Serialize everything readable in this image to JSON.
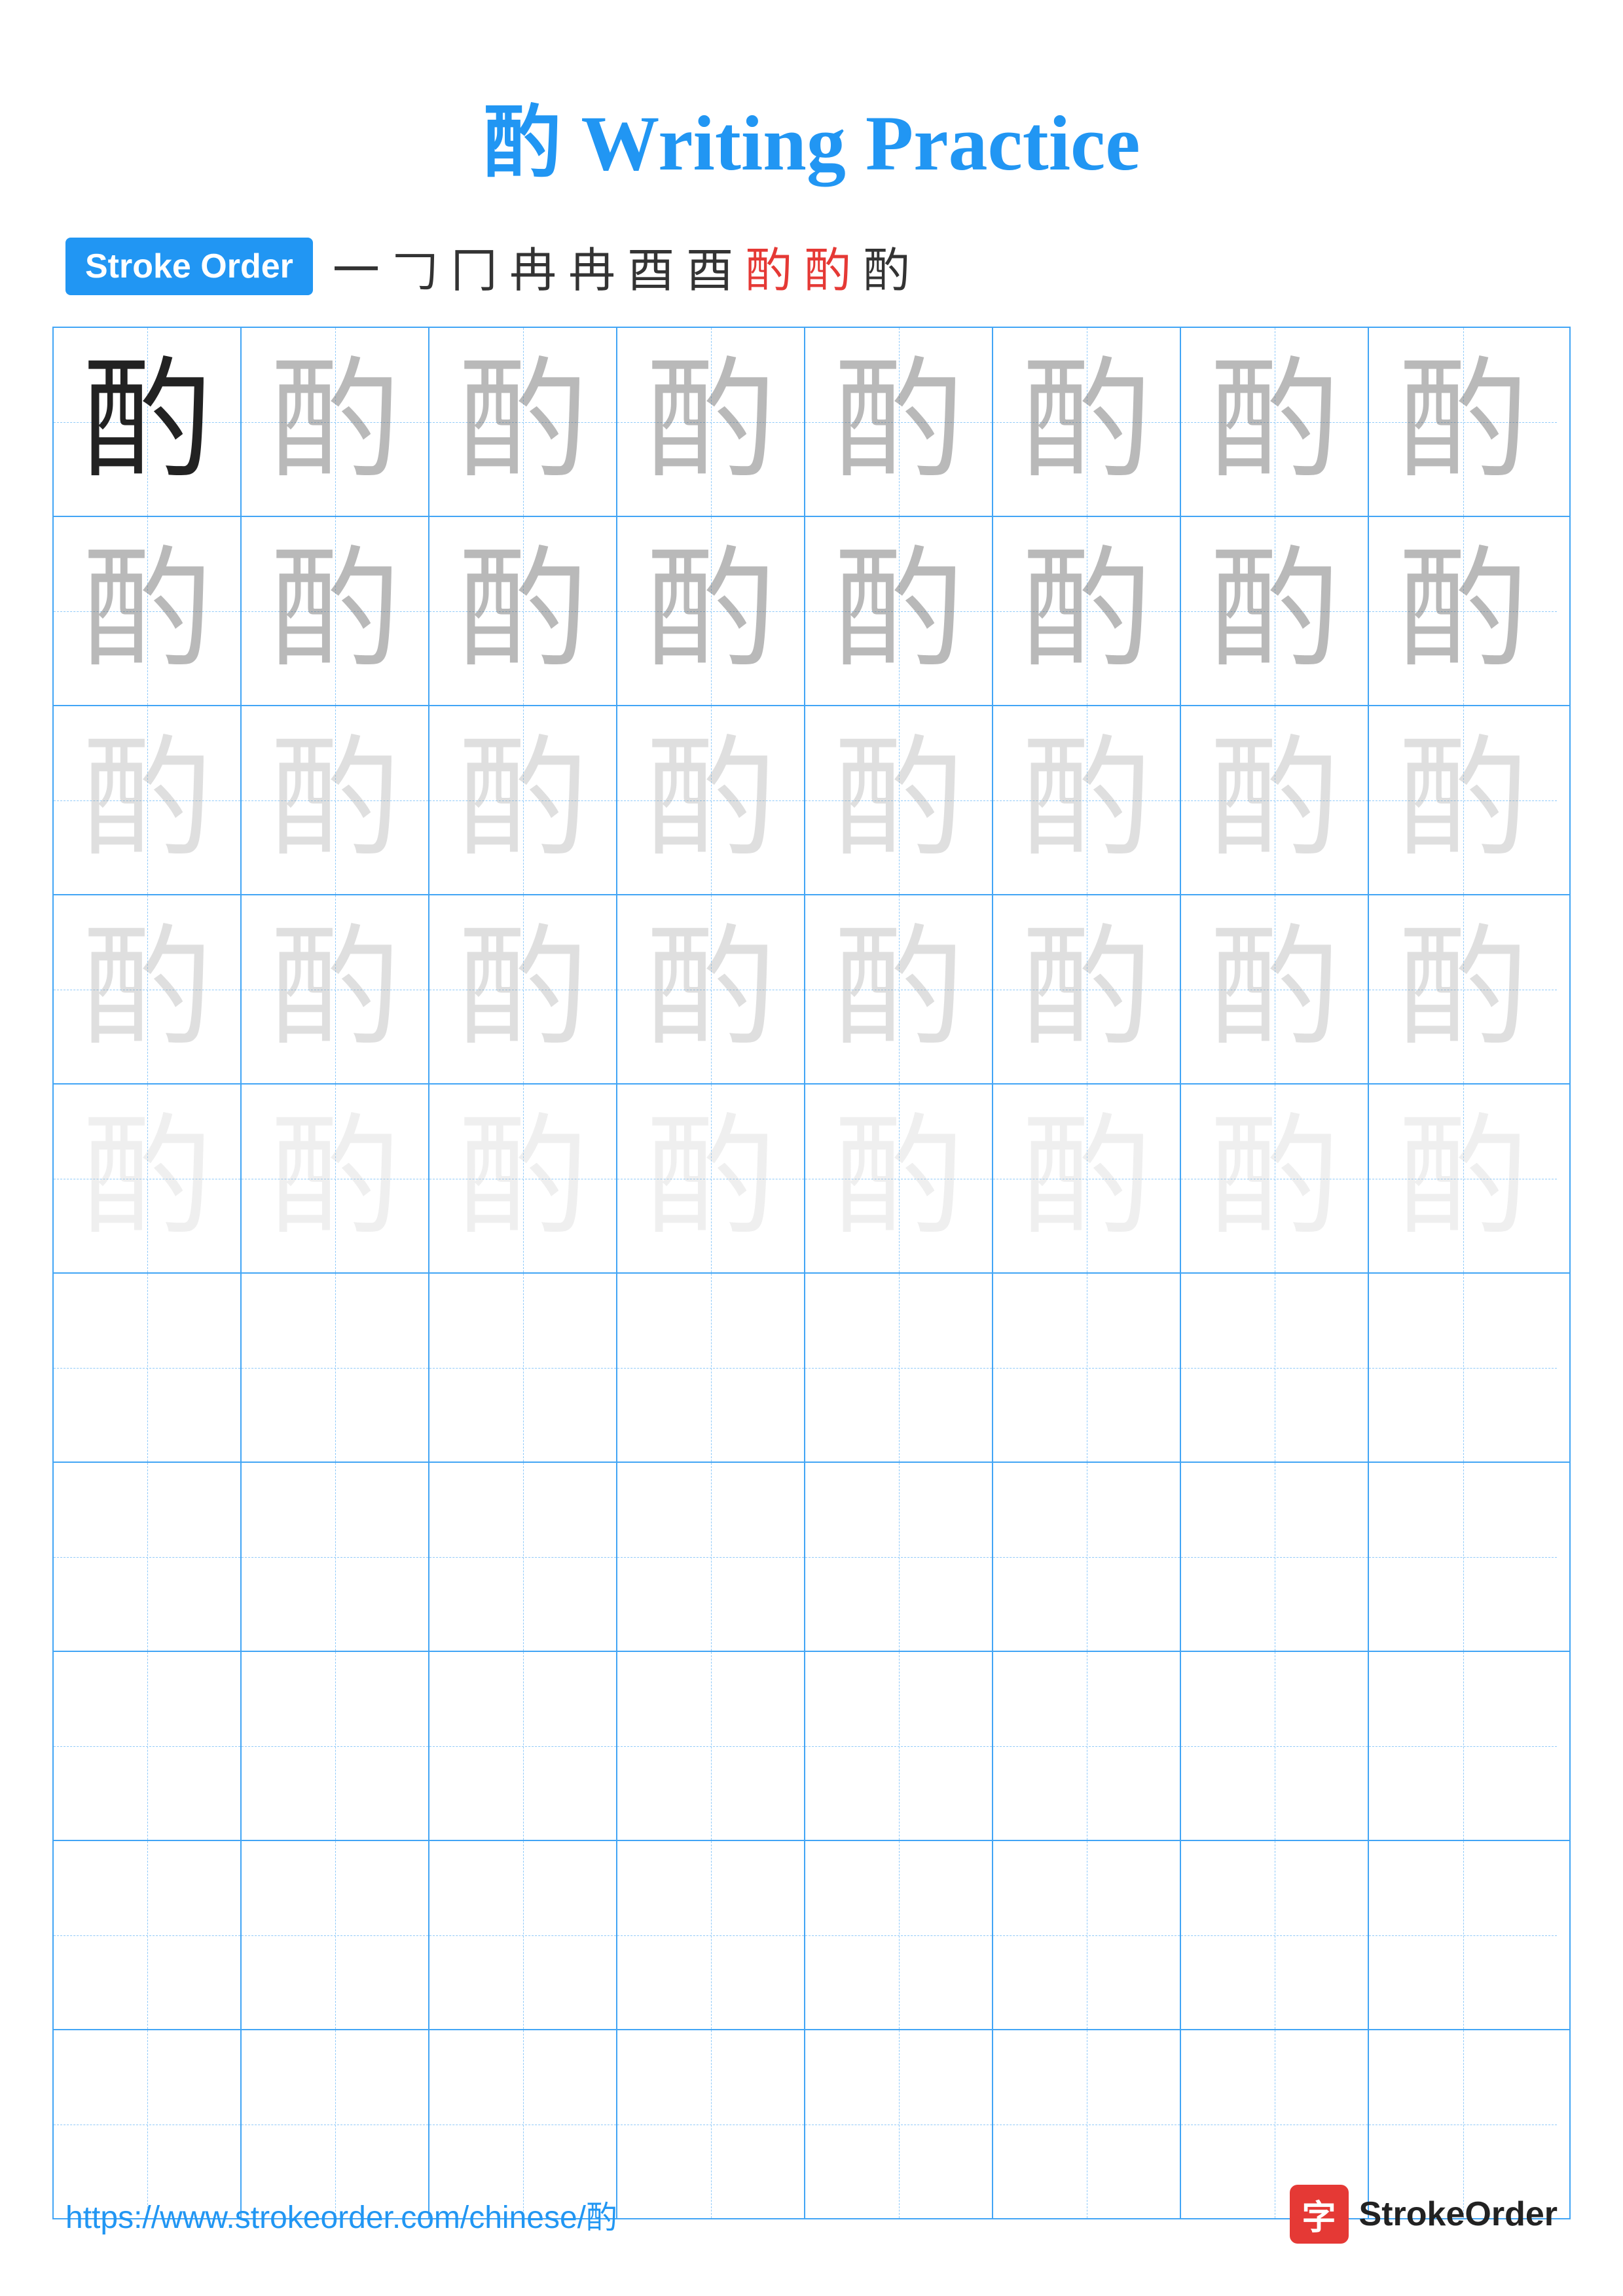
{
  "title": {
    "character": "酌",
    "text": "Writing Practice",
    "full": "酌 Writing Practice"
  },
  "stroke_order": {
    "badge_label": "Stroke Order",
    "strokes": [
      "一",
      "𠃌",
      "冂",
      "冂",
      "冉",
      "酉",
      "酉",
      "酌",
      "酌",
      "酌"
    ]
  },
  "grid": {
    "character": "酌",
    "rows": 10,
    "cols": 8,
    "practice_rows": [
      [
        "dark",
        "light-1",
        "light-1",
        "light-1",
        "light-1",
        "light-1",
        "light-1",
        "light-1"
      ],
      [
        "light-1",
        "light-1",
        "light-1",
        "light-1",
        "light-1",
        "light-1",
        "light-1",
        "light-1"
      ],
      [
        "light-2",
        "light-2",
        "light-2",
        "light-2",
        "light-2",
        "light-2",
        "light-2",
        "light-2"
      ],
      [
        "light-2",
        "light-2",
        "light-2",
        "light-2",
        "light-2",
        "light-2",
        "light-2",
        "light-2"
      ],
      [
        "light-3",
        "light-3",
        "light-3",
        "light-3",
        "light-3",
        "light-3",
        "light-3",
        "light-3"
      ],
      [
        "empty",
        "empty",
        "empty",
        "empty",
        "empty",
        "empty",
        "empty",
        "empty"
      ],
      [
        "empty",
        "empty",
        "empty",
        "empty",
        "empty",
        "empty",
        "empty",
        "empty"
      ],
      [
        "empty",
        "empty",
        "empty",
        "empty",
        "empty",
        "empty",
        "empty",
        "empty"
      ],
      [
        "empty",
        "empty",
        "empty",
        "empty",
        "empty",
        "empty",
        "empty",
        "empty"
      ],
      [
        "empty",
        "empty",
        "empty",
        "empty",
        "empty",
        "empty",
        "empty",
        "empty"
      ]
    ]
  },
  "footer": {
    "url": "https://www.strokeorder.com/chinese/酌",
    "logo_char": "字",
    "logo_text": "StrokeOrder"
  }
}
